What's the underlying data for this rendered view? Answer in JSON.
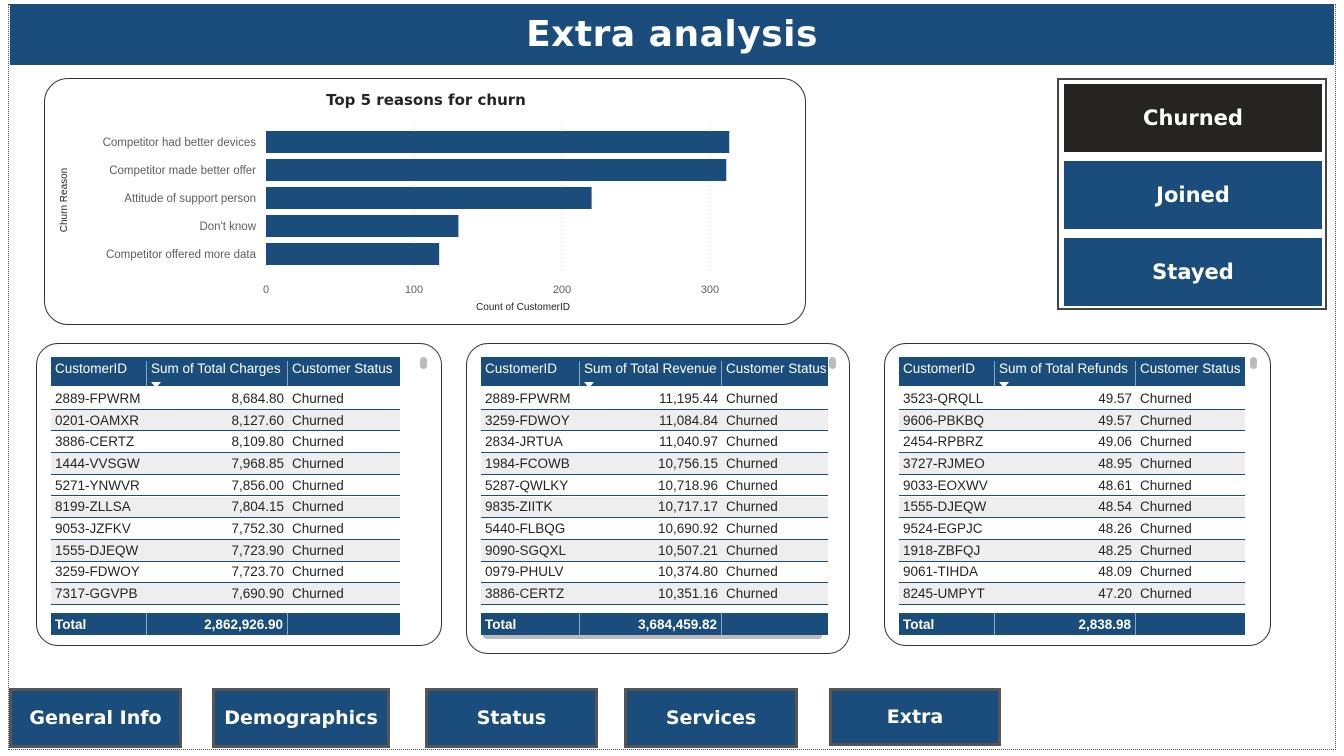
{
  "header": {
    "title": "Extra analysis"
  },
  "chart_data": {
    "type": "bar",
    "orientation": "horizontal",
    "title": "Top 5 reasons for churn",
    "xlabel": "Count of CustomerID",
    "ylabel": "Churn Reason",
    "categories": [
      "Competitor had better devices",
      "Competitor made better offer",
      "Attitude of support person",
      "Don't know",
      "Competitor offered more data"
    ],
    "values": [
      313,
      311,
      220,
      130,
      117
    ],
    "xlim": [
      0,
      340
    ],
    "xticks": [
      "0",
      "100",
      "200",
      "300"
    ],
    "grid": true,
    "color": "#1a4d7c"
  },
  "slicer": {
    "items": [
      {
        "label": "Churned",
        "selected": true
      },
      {
        "label": "Joined",
        "selected": false
      },
      {
        "label": "Stayed",
        "selected": false
      }
    ]
  },
  "tables": [
    {
      "headers": [
        "CustomerID",
        "Sum of Total Charges",
        "Customer Status"
      ],
      "rows": [
        [
          "2889-FPWRM",
          "8,684.80",
          "Churned"
        ],
        [
          "0201-OAMXR",
          "8,127.60",
          "Churned"
        ],
        [
          "3886-CERTZ",
          "8,109.80",
          "Churned"
        ],
        [
          "1444-VVSGW",
          "7,968.85",
          "Churned"
        ],
        [
          "5271-YNWVR",
          "7,856.00",
          "Churned"
        ],
        [
          "8199-ZLLSA",
          "7,804.15",
          "Churned"
        ],
        [
          "9053-JZFKV",
          "7,752.30",
          "Churned"
        ],
        [
          "1555-DJEQW",
          "7,723.90",
          "Churned"
        ],
        [
          "3259-FDWOY",
          "7,723.70",
          "Churned"
        ],
        [
          "7317-GGVPB",
          "7,690.90",
          "Churned"
        ]
      ],
      "total": [
        "Total",
        "2,862,926.90",
        ""
      ]
    },
    {
      "headers": [
        "CustomerID",
        "Sum of Total Revenue",
        "Customer Status"
      ],
      "rows": [
        [
          "2889-FPWRM",
          "11,195.44",
          "Churned"
        ],
        [
          "3259-FDWOY",
          "11,084.84",
          "Churned"
        ],
        [
          "2834-JRTUA",
          "11,040.97",
          "Churned"
        ],
        [
          "1984-FCOWB",
          "10,756.15",
          "Churned"
        ],
        [
          "5287-QWLKY",
          "10,718.96",
          "Churned"
        ],
        [
          "9835-ZIITK",
          "10,717.17",
          "Churned"
        ],
        [
          "5440-FLBQG",
          "10,690.92",
          "Churned"
        ],
        [
          "9090-SGQXL",
          "10,507.21",
          "Churned"
        ],
        [
          "0979-PHULV",
          "10,374.80",
          "Churned"
        ],
        [
          "3886-CERTZ",
          "10,351.16",
          "Churned"
        ]
      ],
      "total": [
        "Total",
        "3,684,459.82",
        ""
      ]
    },
    {
      "headers": [
        "CustomerID",
        "Sum of Total Refunds",
        "Customer Status"
      ],
      "rows": [
        [
          "3523-QRQLL",
          "49.57",
          "Churned"
        ],
        [
          "9606-PBKBQ",
          "49.57",
          "Churned"
        ],
        [
          "2454-RPBRZ",
          "49.06",
          "Churned"
        ],
        [
          "3727-RJMEO",
          "48.95",
          "Churned"
        ],
        [
          "9033-EOXWV",
          "48.61",
          "Churned"
        ],
        [
          "1555-DJEQW",
          "48.54",
          "Churned"
        ],
        [
          "9524-EGPJC",
          "48.26",
          "Churned"
        ],
        [
          "1918-ZBFQJ",
          "48.25",
          "Churned"
        ],
        [
          "9061-TIHDA",
          "48.09",
          "Churned"
        ],
        [
          "8245-UMPYT",
          "47.20",
          "Churned"
        ]
      ],
      "total": [
        "Total",
        "2,838.98",
        ""
      ]
    }
  ],
  "nav": {
    "buttons": [
      "General Info",
      "Demographics",
      "Status",
      "Services",
      "Extra"
    ]
  }
}
